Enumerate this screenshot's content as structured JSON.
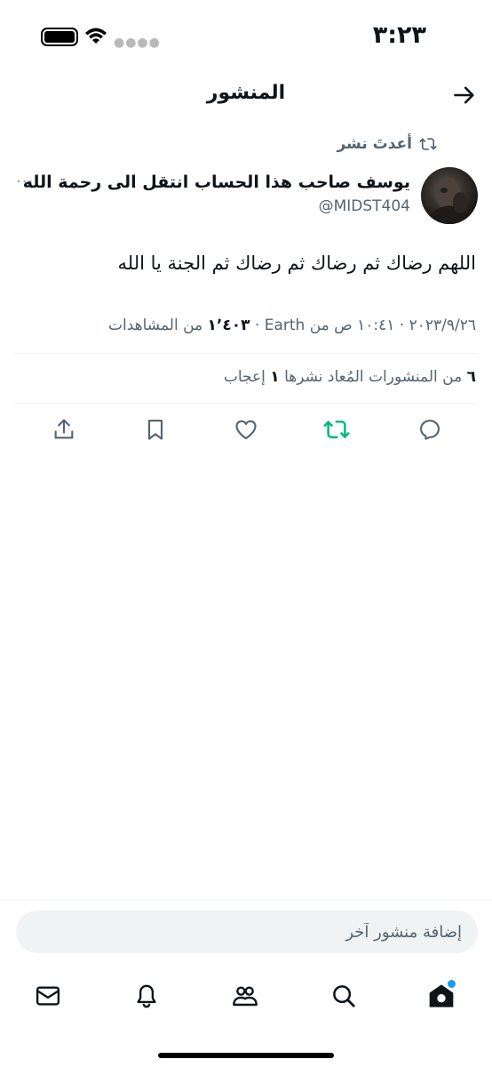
{
  "status_bar": {
    "time": "٣:٢٣",
    "icons": [
      "battery-icon",
      "wifi-icon",
      "cellular-signal-icon"
    ]
  },
  "header": {
    "title": "المنشور",
    "back_icon": "arrow-right-icon"
  },
  "repost": {
    "label": "أعدتَ نشر",
    "icon": "repost-icon"
  },
  "author": {
    "name": "يوسف صاحب هذا الحساب انتقل الى رحمة الله",
    "handle": "@MIDST404",
    "more_label": "···"
  },
  "post": {
    "text": "اللهم رضاك ثم رضاك ثم رضاك ثم الجنة يا الله",
    "meta_prefix": "٢٠٢٣/٩/٢٦ · ١٠:٤١ ص من Earth · ",
    "views_count": "١٬٤٠٣",
    "views_label": " من المشاهدات"
  },
  "stats": {
    "reposts_count": "٦",
    "reposts_label": " من المنشورات المُعاد نشرها  ",
    "likes_count": "١",
    "likes_label": " إعجاب"
  },
  "actions": {
    "reply_icon": "reply-icon",
    "repost_icon": "repost-icon",
    "like_icon": "heart-icon",
    "bookmark_icon": "bookmark-icon",
    "share_icon": "share-icon",
    "repost_active_color": "#00ba7c"
  },
  "reply_bar": {
    "placeholder": "إضافة منشور آخر"
  },
  "tab_bar": {
    "items": [
      "home-icon",
      "search-icon",
      "communities-icon",
      "notifications-icon",
      "messages-icon"
    ],
    "accent": "#1d9bf0"
  }
}
